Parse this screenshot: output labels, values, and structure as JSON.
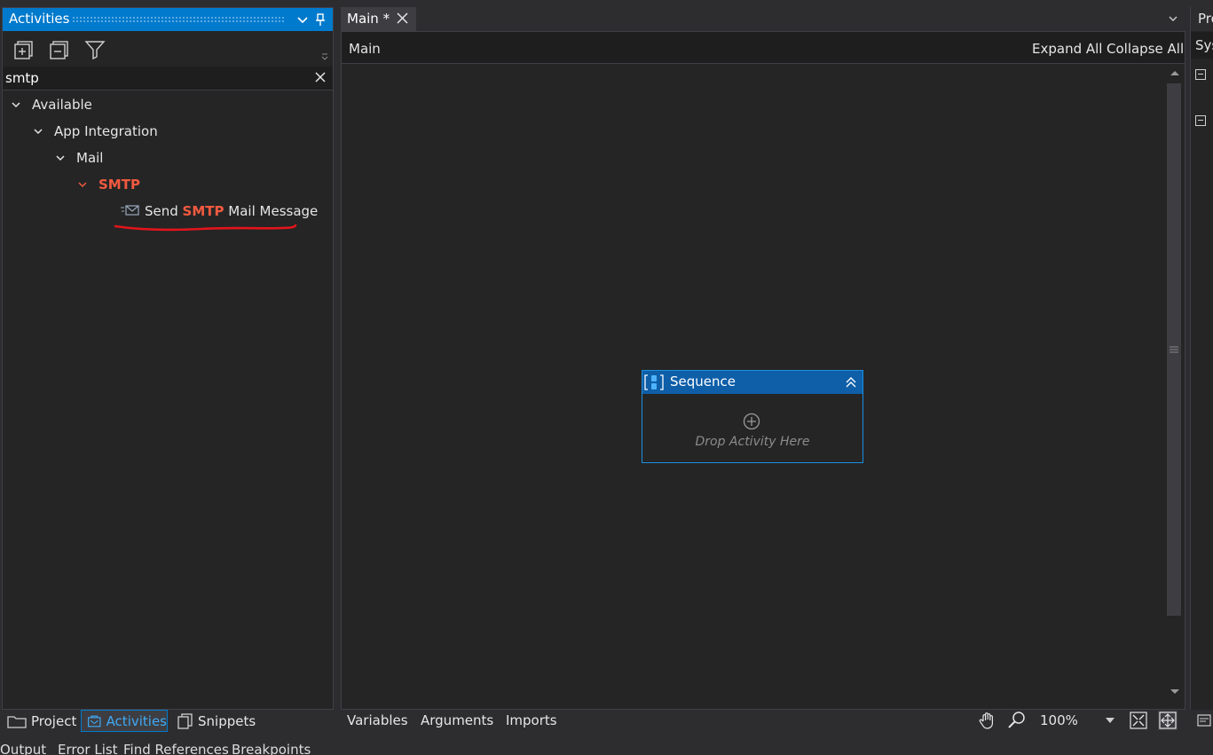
{
  "activities_panel": {
    "title": "Activities",
    "search_value": "smtp",
    "tree": {
      "available": "Available",
      "app_integration": "App Integration",
      "mail": "Mail",
      "smtp": "SMTP",
      "leaf_prefix": "Send ",
      "leaf_highlight": "SMTP",
      "leaf_suffix": " Mail Message"
    }
  },
  "left_tabs": {
    "project": "Project",
    "activities": "Activities",
    "snippets": "Snippets"
  },
  "editor": {
    "tab_label": "Main *",
    "breadcrumb": "Main",
    "expand_all": "Expand All",
    "collapse_all": "Collapse All",
    "sequence": {
      "title": "Sequence",
      "drop_hint": "Drop Activity Here"
    },
    "footer": {
      "variables": "Variables",
      "arguments": "Arguments",
      "imports": "Imports",
      "zoom": "100%"
    }
  },
  "right_panel": {
    "title": "Pro",
    "sys": "Sys"
  },
  "bottom_tabs": {
    "output": "Output",
    "error_list": "Error List",
    "find_references": "Find References",
    "breakpoints": "Breakpoints"
  },
  "colors": {
    "accent": "#007acc",
    "highlight": "#f25a3f",
    "annotation": "#e3141b"
  }
}
